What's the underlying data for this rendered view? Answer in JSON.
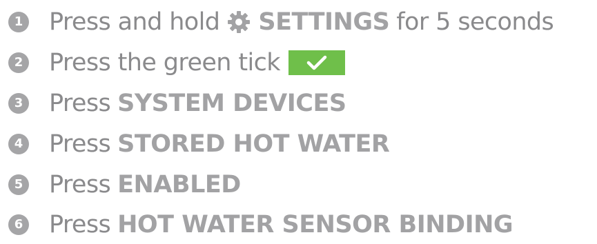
{
  "steps": [
    {
      "number": "1",
      "verb": "Press and hold",
      "keyword": "SETTINGS",
      "suffix": "for 5 seconds",
      "icon": "gear-icon"
    },
    {
      "number": "2",
      "verb": "Press the green tick",
      "icon": "green-tick-icon",
      "tick_color": "#6fbf4a"
    },
    {
      "number": "3",
      "verb": "Press",
      "keyword": "SYSTEM DEVICES"
    },
    {
      "number": "4",
      "verb": "Press",
      "keyword": "STORED HOT WATER"
    },
    {
      "number": "5",
      "verb": "Press",
      "keyword": "ENABLED"
    },
    {
      "number": "6",
      "verb": "Press",
      "keyword": "HOT WATER SENSOR BINDING"
    }
  ],
  "colors": {
    "text": "#8a8a8c",
    "keyword": "#a2a2a4",
    "badge": "#a5a5a7",
    "tick_box": "#6fbf4a"
  }
}
